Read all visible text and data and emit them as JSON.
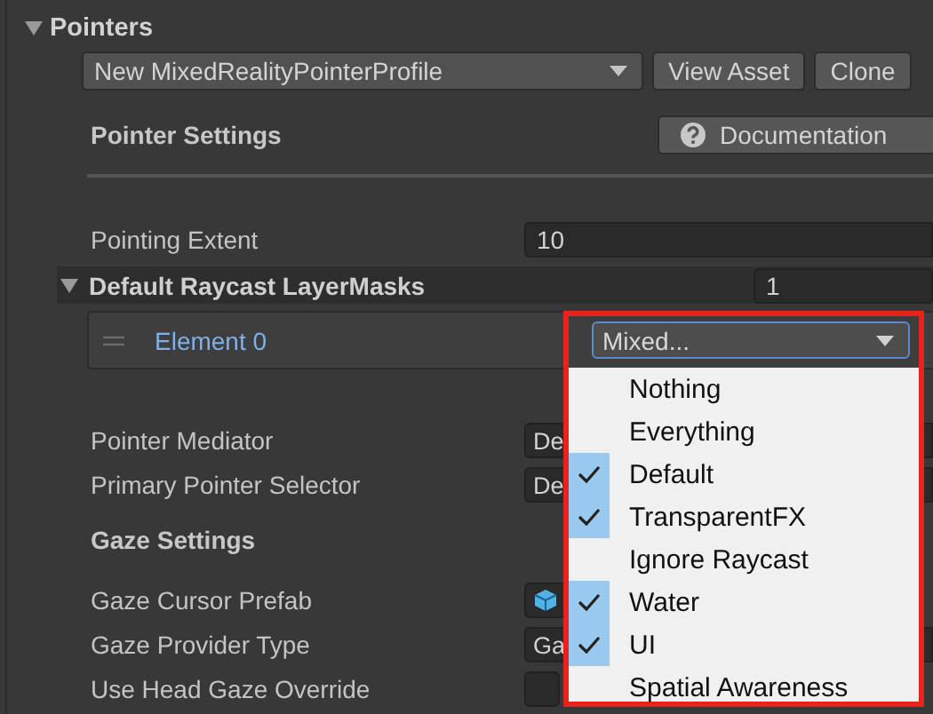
{
  "section": {
    "title": "Pointers",
    "expanded": true
  },
  "profile": {
    "value": "New MixedRealityPointerProfile",
    "buttons": [
      "View Asset",
      "Clone"
    ]
  },
  "pointer_settings": {
    "title": "Pointer Settings",
    "doc_button": "Documentation"
  },
  "pointing_extent": {
    "label": "Pointing Extent",
    "value": "10"
  },
  "layer_masks": {
    "title": "Default Raycast LayerMasks",
    "expanded": true,
    "size": "1",
    "elements": [
      {
        "label": "Element 0",
        "value": "Mixed..."
      }
    ]
  },
  "fields": [
    {
      "label": "Pointer Mediator",
      "value": "De"
    },
    {
      "label": "Primary Pointer Selector",
      "value": "De"
    }
  ],
  "gaze_settings": {
    "title": "Gaze Settings",
    "fields": [
      {
        "label": "Gaze Cursor Prefab",
        "kind": "object"
      },
      {
        "label": "Gaze Provider Type",
        "kind": "text",
        "value": "Ga"
      },
      {
        "label": "Use Head Gaze Override",
        "kind": "checkbox",
        "checked": false
      }
    ]
  },
  "layer_menu": {
    "items": [
      {
        "label": "Nothing",
        "checked": false
      },
      {
        "label": "Everything",
        "checked": false
      },
      {
        "label": "Default",
        "checked": true
      },
      {
        "label": "TransparentFX",
        "checked": true
      },
      {
        "label": "Ignore Raycast",
        "checked": false
      },
      {
        "label": "Water",
        "checked": true
      },
      {
        "label": "UI",
        "checked": true
      },
      {
        "label": "Spatial Awareness",
        "checked": false
      }
    ]
  }
}
